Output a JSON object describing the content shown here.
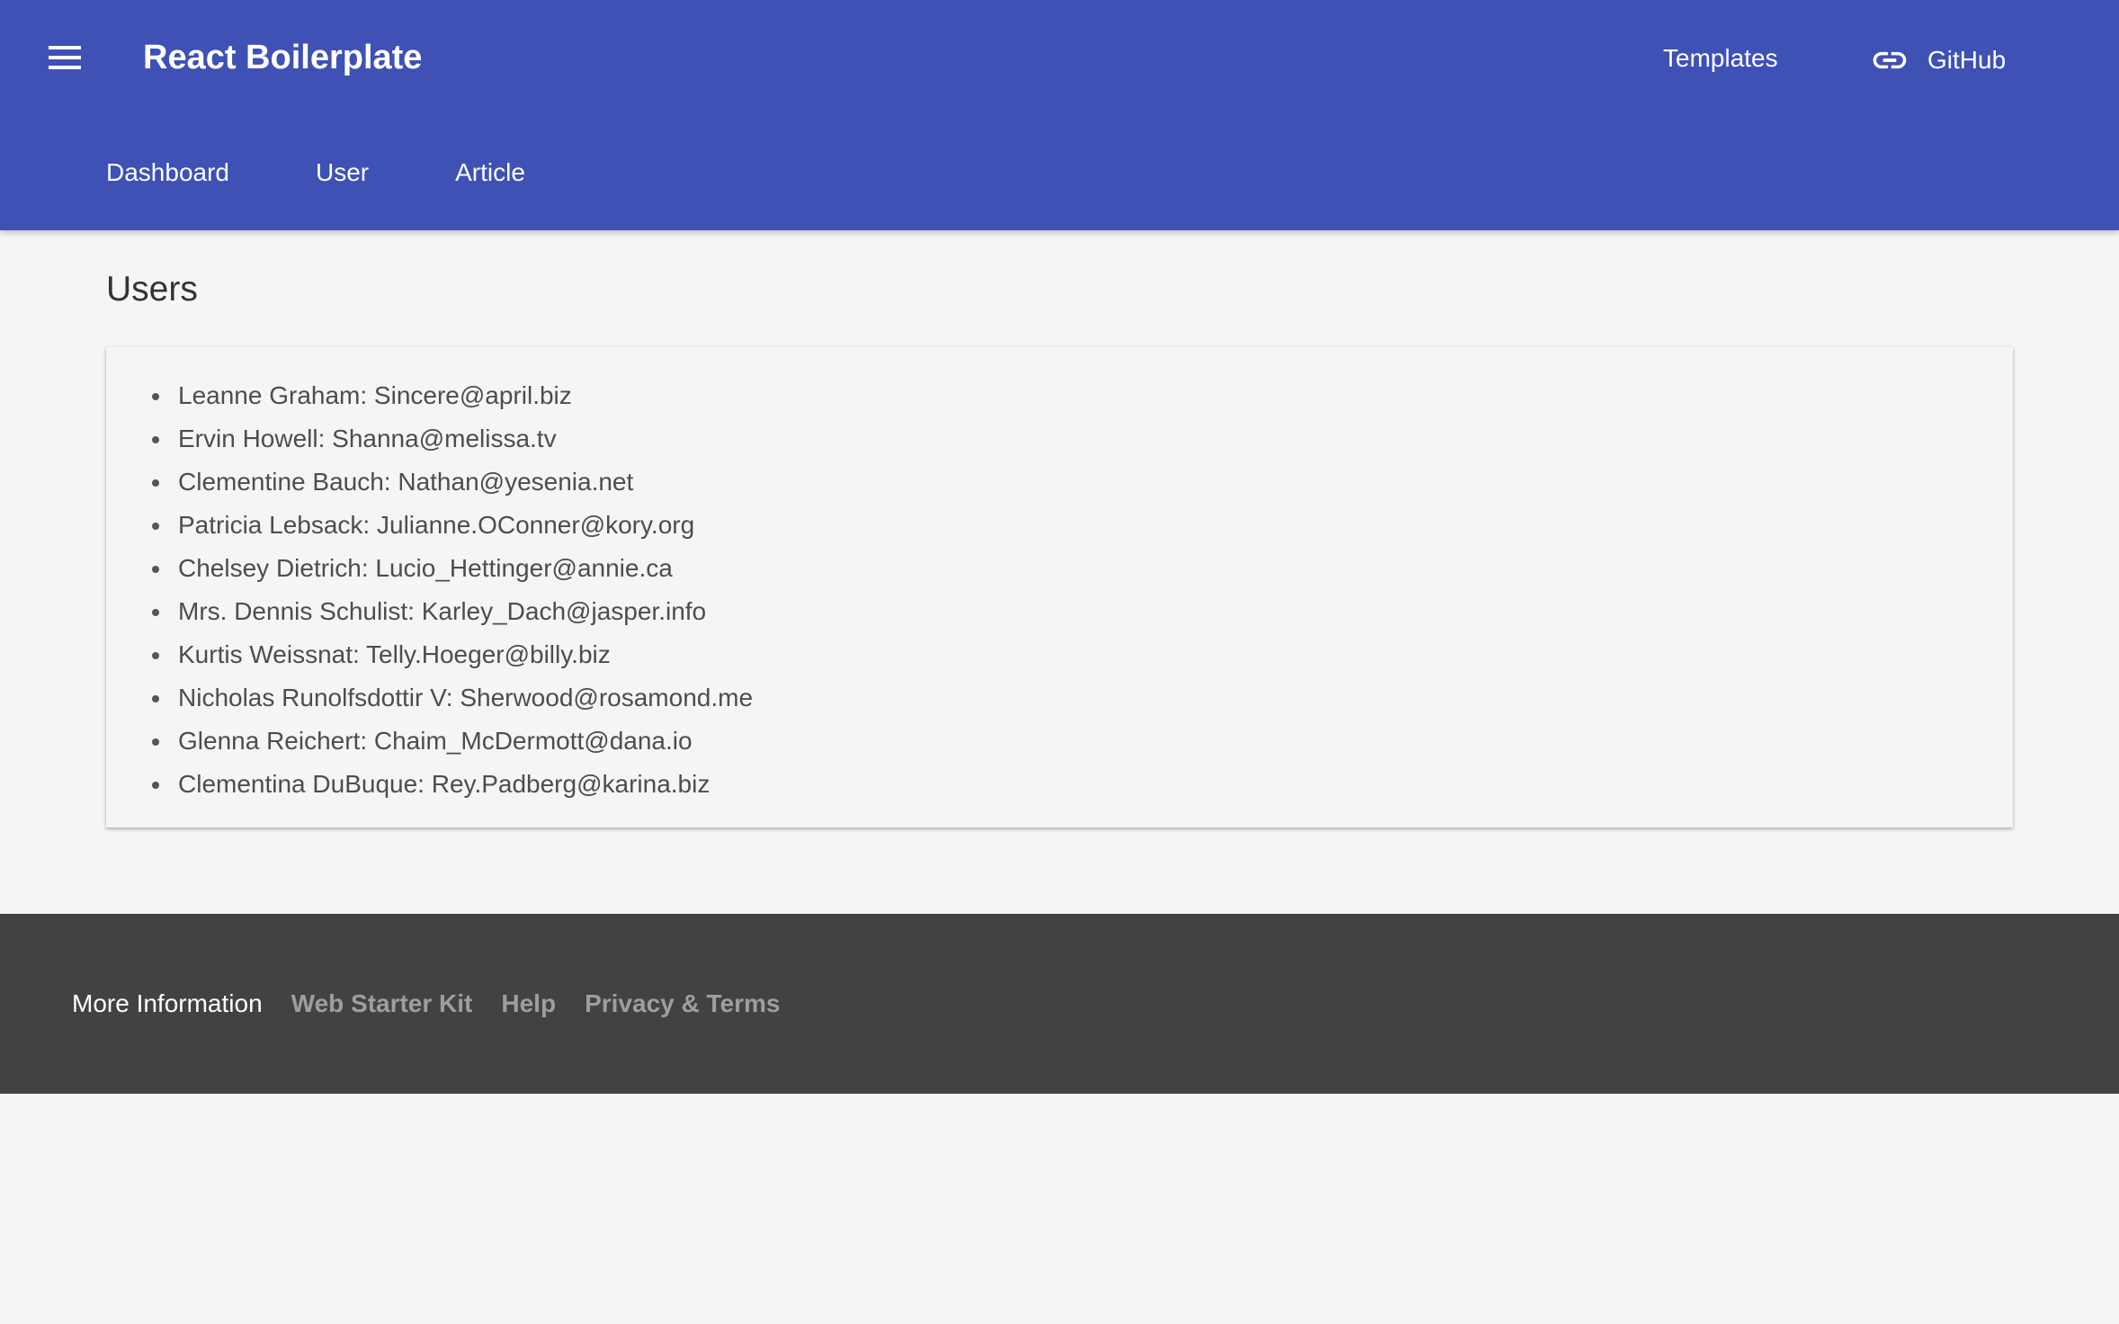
{
  "header": {
    "menu_icon": "hamburger-menu-icon",
    "title": "React Boilerplate",
    "templates_label": "Templates",
    "github_icon": "link-icon",
    "github_label": "GitHub",
    "background_color": "#3f51b5"
  },
  "tabs": [
    {
      "label": "Dashboard"
    },
    {
      "label": "User"
    },
    {
      "label": "Article"
    }
  ],
  "main": {
    "title": "Users",
    "users": [
      "Leanne Graham: Sincere@april.biz",
      "Ervin Howell: Shanna@melissa.tv",
      "Clementine Bauch: Nathan@yesenia.net",
      "Patricia Lebsack: Julianne.OConner@kory.org",
      "Chelsey Dietrich: Lucio_Hettinger@annie.ca",
      "Mrs. Dennis Schulist: Karley_Dach@jasper.info",
      "Kurtis Weissnat: Telly.Hoeger@billy.biz",
      "Nicholas Runolfsdottir V: Sherwood@rosamond.me",
      "Glenna Reichert: Chaim_McDermott@dana.io",
      "Clementina DuBuque: Rey.Padberg@karina.biz"
    ]
  },
  "footer": {
    "heading": "More Information",
    "links": [
      {
        "label": "Web Starter Kit"
      },
      {
        "label": "Help"
      },
      {
        "label": "Privacy & Terms"
      }
    ],
    "background_color": "#424242"
  }
}
